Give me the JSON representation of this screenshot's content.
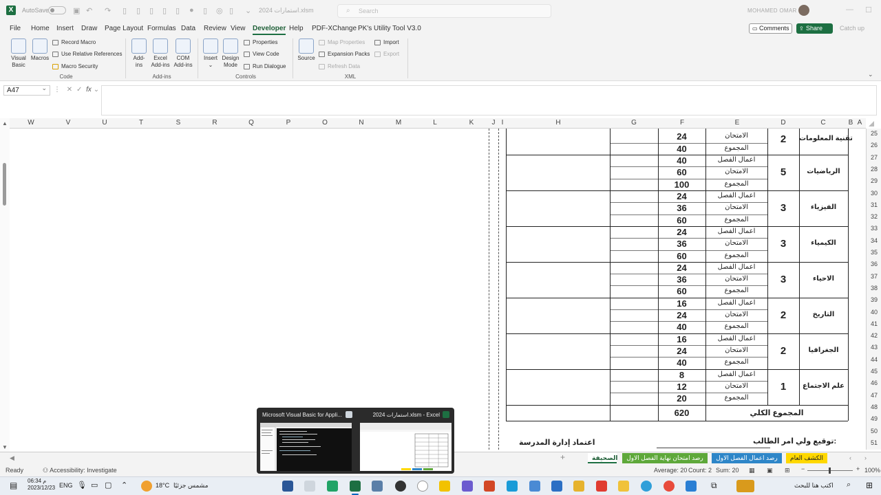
{
  "titlebar": {
    "autosave": "AutoSave",
    "doc_title": "استمارات 2024.xlsm",
    "search_placeholder": "Search",
    "user": "MOHAMED OMAR"
  },
  "tabs": [
    "File",
    "Home",
    "Insert",
    "Draw",
    "Page Layout",
    "Formulas",
    "Data",
    "Review",
    "View",
    "Developer",
    "Help",
    "PDF-XChange",
    "PK's Utility Tool V3.0"
  ],
  "active_tab": "Developer",
  "actions": {
    "comments": "Comments",
    "share": "Share",
    "catchup": "Catch up"
  },
  "ribbon": {
    "code": {
      "label": "Code",
      "visual_basic": [
        "Visual",
        "Basic"
      ],
      "macros": "Macros",
      "record_macro": "Record Macro",
      "relative_refs": "Use Relative References",
      "macro_security": "Macro Security"
    },
    "addins": {
      "label": "Add-ins",
      "addins": [
        "Add-",
        "ins"
      ],
      "excel_addins": [
        "Excel",
        "Add-ins"
      ],
      "com_addins": [
        "COM",
        "Add-ins"
      ]
    },
    "controls": {
      "label": "Controls",
      "insert": "Insert",
      "design_mode": [
        "Design",
        "Mode"
      ],
      "properties": "Properties",
      "view_code": "View Code",
      "run_dialog": "Run Dialogue"
    },
    "xml": {
      "label": "XML",
      "source": "Source",
      "map_properties": "Map Properties",
      "expansion_packs": "Expansion Packs",
      "refresh_data": "Refresh Data",
      "import": "Import",
      "export": "Export"
    }
  },
  "formula_bar": {
    "name_box": "A47",
    "fx": "fx"
  },
  "columns": [
    "W",
    "V",
    "U",
    "T",
    "S",
    "R",
    "Q",
    "P",
    "O",
    "N",
    "M",
    "L",
    "K",
    "J",
    "I",
    "H",
    "G",
    "F",
    "E",
    "D",
    "C",
    "B",
    "A"
  ],
  "rows": [
    "25",
    "26",
    "27",
    "28",
    "29",
    "30",
    "31",
    "32",
    "33",
    "34",
    "35",
    "36",
    "37",
    "38",
    "39",
    "40",
    "41",
    "42",
    "43",
    "44",
    "45",
    "46",
    "47",
    "48",
    "49",
    "50",
    "51"
  ],
  "report": {
    "subjects": [
      {
        "name": "تقنية المعلومات",
        "hours": "2",
        "rows": [
          {
            "label": "الامتحان",
            "value": "24"
          },
          {
            "label": "المجموع",
            "value": "40"
          }
        ]
      },
      {
        "name": "الرياضيات",
        "hours": "5",
        "rows": [
          {
            "label": "اعمال الفصل",
            "value": "40"
          },
          {
            "label": "الامتحان",
            "value": "60"
          },
          {
            "label": "المجموع",
            "value": "100"
          }
        ]
      },
      {
        "name": "الفيزياء",
        "hours": "3",
        "rows": [
          {
            "label": "اعمال الفصل",
            "value": "24"
          },
          {
            "label": "الامتحان",
            "value": "36"
          },
          {
            "label": "المجموع",
            "value": "60"
          }
        ]
      },
      {
        "name": "الكيمياء",
        "hours": "3",
        "rows": [
          {
            "label": "اعمال الفصل",
            "value": "24"
          },
          {
            "label": "الامتحان",
            "value": "36"
          },
          {
            "label": "المجموع",
            "value": "60"
          }
        ]
      },
      {
        "name": "الاحياء",
        "hours": "3",
        "rows": [
          {
            "label": "اعمال الفصل",
            "value": "24"
          },
          {
            "label": "الامتحان",
            "value": "36"
          },
          {
            "label": "المجموع",
            "value": "60"
          }
        ]
      },
      {
        "name": "التاريخ",
        "hours": "2",
        "rows": [
          {
            "label": "اعمال الفصل",
            "value": "16"
          },
          {
            "label": "الامتحان",
            "value": "24"
          },
          {
            "label": "المجموع",
            "value": "40"
          }
        ]
      },
      {
        "name": "الجغرافيا",
        "hours": "2",
        "rows": [
          {
            "label": "اعمال الفصل",
            "value": "16"
          },
          {
            "label": "الامتحان",
            "value": "24"
          },
          {
            "label": "المجموع",
            "value": "40"
          }
        ]
      },
      {
        "name": "علم الاجتماع",
        "hours": "1",
        "rows": [
          {
            "label": "اعمال الفصل",
            "value": "8"
          },
          {
            "label": "الامتحان",
            "value": "12"
          },
          {
            "label": "المجموع",
            "value": "20"
          }
        ]
      }
    ],
    "total_label": "المجموع الكلي",
    "total_value": "620",
    "guardian_signature": "توقيع ولي امر الطالب:",
    "school_approval": "اعتماد إدارة المدرسة"
  },
  "sheet_tabs": [
    {
      "label": "الكشف العام",
      "color": "yellow"
    },
    {
      "label": "رصد اعمال الفصل الاول",
      "color": "blue"
    },
    {
      "label": "رصد امتحان نهاية الفصل الاول",
      "color": "green"
    },
    {
      "label": "الصحيفة",
      "color": "active"
    }
  ],
  "add_sheet": "+",
  "status": {
    "ready": "Ready",
    "accessibility": "Accessibility: Investigate",
    "average": "Average: 20",
    "count": "Count: 2",
    "sum": "Sum: 20",
    "zoom": "100%"
  },
  "preview": {
    "vba_title": "Microsoft Visual Basic for Appli...",
    "excel_title": "استمارات 2024.xlsm - Excel"
  },
  "taskbar": {
    "search_text": "اكتب هنا للبحث",
    "weather_temp": "18°C",
    "weather_desc": "مشمس جزئيًا",
    "lang": "ENG",
    "time": "06:34 م",
    "date": "2023/12/23"
  }
}
